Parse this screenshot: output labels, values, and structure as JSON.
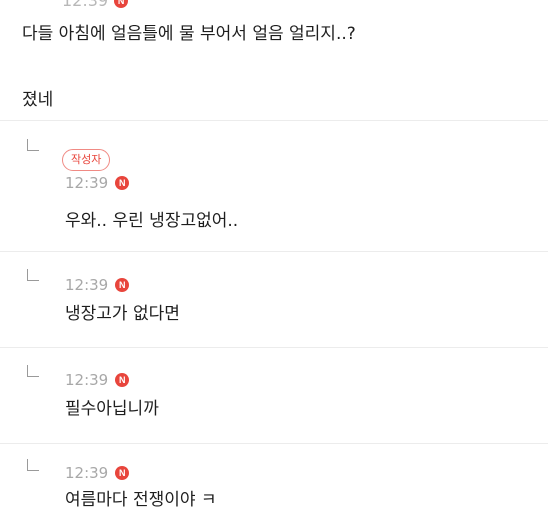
{
  "top_partial_time": "12:39",
  "main_comment": {
    "text_line1": "다들 아침에 얼음틀에 물 부어서 얼음 얼리지..?",
    "text_line2": "졌네"
  },
  "new_badge": "N",
  "replies": [
    {
      "author_tag": "작성자",
      "time": "12:39",
      "text": "우와.. 우린 냉장고없어.."
    },
    {
      "time": "12:39",
      "text": "냉장고가 없다면"
    },
    {
      "time": "12:39",
      "text": "필수아닙니까"
    },
    {
      "time": "12:39",
      "text": "여름마다 전쟁이야 ㅋ"
    }
  ],
  "colors": {
    "accent_red": "#e8453c",
    "divider": "#ececec",
    "meta_gray": "#a8a8a8"
  },
  "icons": {
    "reply": "reply-arrow-icon",
    "new": "new-badge-icon"
  }
}
